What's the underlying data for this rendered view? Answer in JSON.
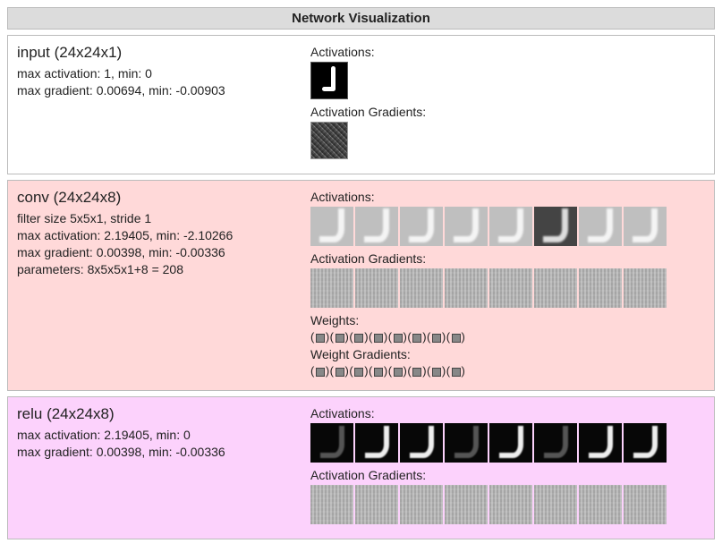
{
  "title": "Network Visualization",
  "labels": {
    "activations": "Activations:",
    "activation_gradients": "Activation Gradients:",
    "weights": "Weights:",
    "weight_gradients": "Weight Gradients:"
  },
  "layers": {
    "input": {
      "title": "input (24x24x1)",
      "line_act": "max activation: 1, min: 0",
      "line_grad": "max gradient: 0.00694, min: -0.00903",
      "activation_count": 1,
      "gradient_count": 1
    },
    "conv": {
      "title": "conv (24x24x8)",
      "line_filter": "filter size 5x5x1, stride 1",
      "line_act": "max activation: 2.19405, min: -2.10266",
      "line_grad": "max gradient: 0.00398, min: -0.00336",
      "line_params": "parameters: 8x5x5x1+8 = 208",
      "activation_count": 8,
      "gradient_count": 8,
      "weight_chips": 8,
      "weight_grad_chips": 8
    },
    "relu": {
      "title": "relu (24x24x8)",
      "line_act": "max activation: 2.19405, min: 0",
      "line_grad": "max gradient: 0.00398, min: -0.00336",
      "activation_count": 8,
      "gradient_count": 8
    }
  }
}
